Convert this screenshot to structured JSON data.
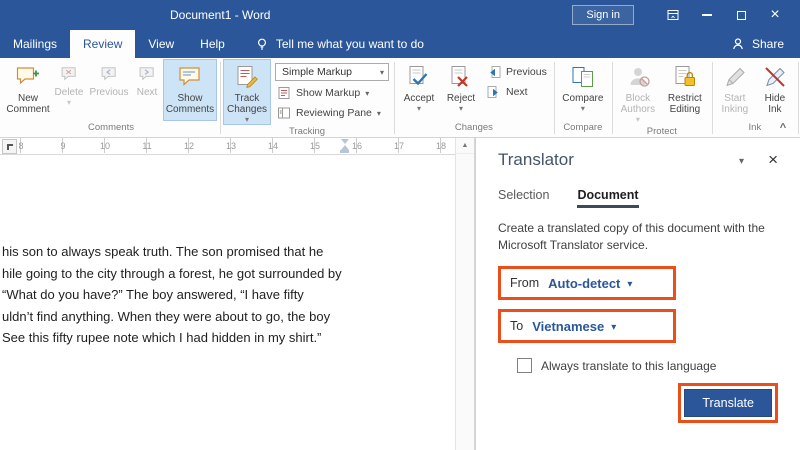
{
  "colors": {
    "accent": "#2b579a",
    "annotation": "#ea4f1b",
    "selected_button_bg": "#cde4f7"
  },
  "title_bar": {
    "title": "Document1 - Word",
    "sign_in": "Sign in"
  },
  "tab_bar": {
    "tabs": [
      "Mailings",
      "Review",
      "View",
      "Help"
    ],
    "active_tab": "Review",
    "tell_me": "Tell me what you want to do",
    "share": "Share"
  },
  "ribbon": {
    "group_labels": [
      "Comments",
      "Tracking",
      "Changes",
      "Compare",
      "Protect",
      "Ink"
    ],
    "comments": {
      "new_comment": "New Comment",
      "delete": "Delete",
      "previous": "Previous",
      "next": "Next",
      "show_comments": "Show Comments"
    },
    "tracking": {
      "track_changes": "Track Changes",
      "simple_markup": "Simple Markup",
      "show_markup": "Show Markup",
      "reviewing_pane": "Reviewing Pane"
    },
    "changes": {
      "accept": "Accept",
      "reject": "Reject",
      "previous": "Previous",
      "next": "Next"
    },
    "compare_group": {
      "compare": "Compare"
    },
    "protect": {
      "block_authors": "Block Authors",
      "restrict_editing": "Restrict Editing"
    },
    "ink": {
      "start_inking": "Start Inking",
      "hide_ink": "Hide Ink"
    }
  },
  "ruler": {
    "numbers": [
      "8",
      "9",
      "10",
      "11",
      "12",
      "13",
      "14",
      "15",
      "16",
      "17",
      "18"
    ]
  },
  "document": {
    "lines": [
      "his son to always speak truth. The son promised that he",
      "hile going to the city through a forest, he got surrounded by",
      "“What do you have?” The boy answered, “I have fifty",
      "uldn’t find anything. When they were about to go, the boy",
      "See this fifty rupee note which I had hidden in my shirt.”"
    ]
  },
  "translator": {
    "title": "Translator",
    "tab_selection": "Selection",
    "tab_document": "Document",
    "description": "Create a translated copy of this document with the Microsoft Translator service.",
    "from_label": "From",
    "from_value": "Auto-detect",
    "to_label": "To",
    "to_value": "Vietnamese",
    "always_translate_label": "Always translate to this language",
    "translate_button": "Translate"
  }
}
